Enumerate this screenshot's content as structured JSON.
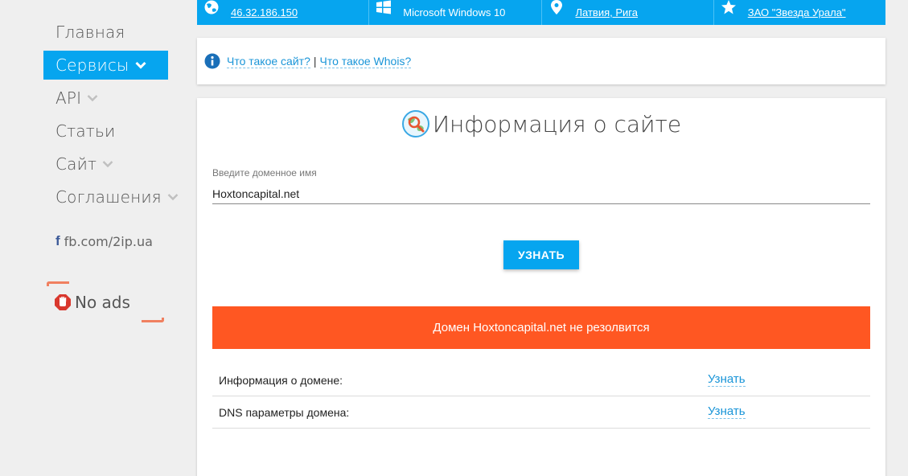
{
  "sidebar": {
    "items": [
      {
        "label": "Главная",
        "active": false,
        "has_dropdown": false
      },
      {
        "label": "Сервисы",
        "active": true,
        "has_dropdown": true
      },
      {
        "label": "API",
        "active": false,
        "has_dropdown": true
      },
      {
        "label": "Статьи",
        "active": false,
        "has_dropdown": false
      },
      {
        "label": "Сайт",
        "active": false,
        "has_dropdown": true
      },
      {
        "label": "Соглашения",
        "active": false,
        "has_dropdown": true
      }
    ],
    "social": {
      "label": "fb.com/2ip.ua",
      "icon": "facebook-icon"
    },
    "noads": {
      "label": "No ads",
      "icon": "stop-hand-icon"
    }
  },
  "topbar": {
    "cells": [
      {
        "icon": "globe-icon",
        "text": "46.32.186.150",
        "link": true
      },
      {
        "icon": "windows-icon",
        "text": "Microsoft Windows 10",
        "link": false
      },
      {
        "icon": "location-pin-icon",
        "text": "Латвия, Рига",
        "link": true
      },
      {
        "icon": "star-icon",
        "text": "ЗАО \"Звезда Урала\"",
        "link": true
      }
    ]
  },
  "info_links": {
    "icon": "info-icon",
    "link1": "Что такое сайт?",
    "separator": "|",
    "link2": "Что такое Whois?"
  },
  "card": {
    "title": "Информация о сайте",
    "title_icon": "globe-magnifier-icon",
    "input": {
      "label": "Введите доменное имя",
      "value": "Hoxtoncapital.net"
    },
    "button": "УЗНАТЬ",
    "alert": "Домен Hoxtoncapital.net не резолвится",
    "rows": [
      {
        "label": "Информация о домене:",
        "link": "Узнать"
      },
      {
        "label": "DNS параметры домена:",
        "link": "Узнать"
      }
    ]
  },
  "colors": {
    "accent": "#06a5ef",
    "alert": "#ff5722",
    "link": "#1a95d8",
    "background": "#efefef"
  }
}
